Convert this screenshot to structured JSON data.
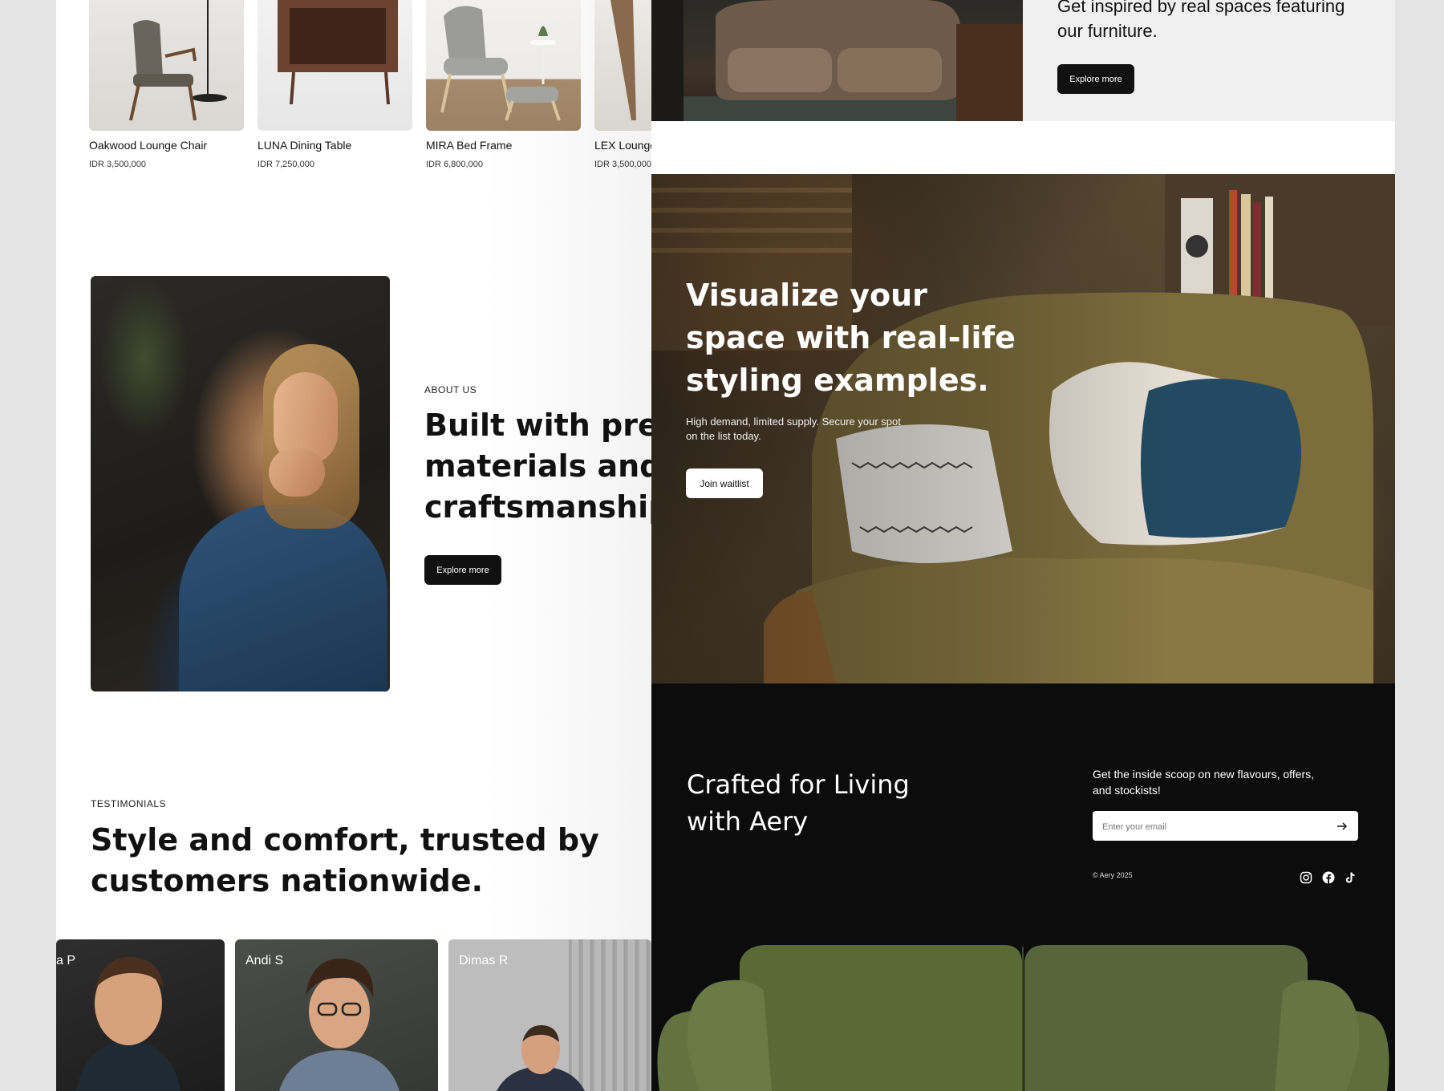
{
  "products": [
    {
      "name": "Oakwood Lounge Chair",
      "price": "IDR 3,500,000"
    },
    {
      "name": "LUNA Dining Table",
      "price": "IDR 7,250,000"
    },
    {
      "name": "MIRA Bed Frame",
      "price": "IDR 6,800,000"
    },
    {
      "name": "LEX Lounge",
      "price": "IDR 3,500,000"
    }
  ],
  "about": {
    "eyebrow": "ABOUT US",
    "heading_line1": "Built with prem",
    "heading_line2": "materials and a",
    "heading_line3": "craftsmanship",
    "button": "Explore more"
  },
  "testimonials": {
    "eyebrow": "TESTIMONIALS",
    "heading_line1": "Style and comfort, trusted by",
    "heading_line2": "customers nationwide.",
    "cards": [
      {
        "name": "a P"
      },
      {
        "name": "Andi S"
      },
      {
        "name": "Dimas R"
      }
    ]
  },
  "inspire": {
    "text_line1": "Get inspired by real spaces featuring",
    "text_line2": "our furniture.",
    "button": "Explore more"
  },
  "hero": {
    "heading_line1": "Visualize your",
    "heading_line2": "space with real-life",
    "heading_line3": "styling examples.",
    "sub_line1": "High demand, limited supply. Secure your spot",
    "sub_line2": "on the list today.",
    "button": "Join waitlist"
  },
  "footer": {
    "heading_line1": "Crafted for Living",
    "heading_line2": "with Aery",
    "newsletter_line1": "Get the inside scoop on new flavours, offers,",
    "newsletter_line2": "and stockists!",
    "email_placeholder": "Enter your email",
    "copyright": "© Aery 2025",
    "social_icons": [
      "instagram-icon",
      "facebook-icon",
      "tiktok-icon"
    ]
  },
  "colors": {
    "dark": "#111111",
    "footer_bg": "#0c0c0c",
    "sofa_green": "#5f6e3a",
    "panel_gray": "#f1f0f0"
  }
}
